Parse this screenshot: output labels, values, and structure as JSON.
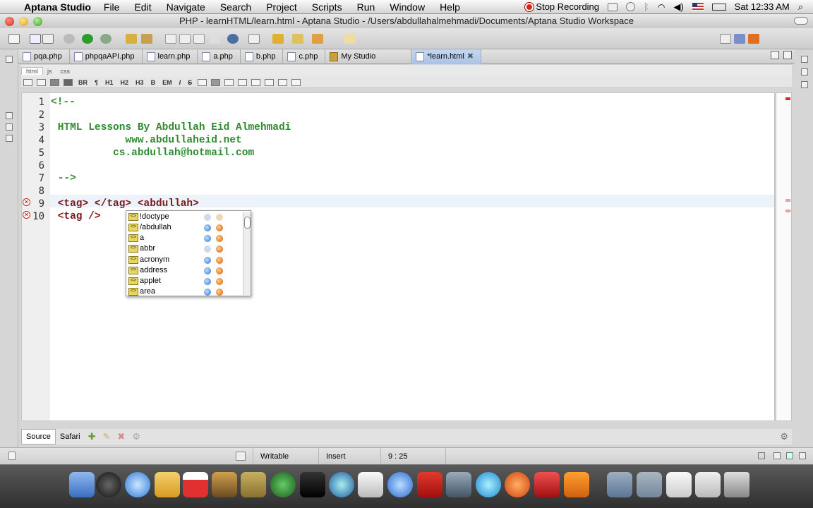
{
  "menubar": {
    "app_name": "Aptana Studio",
    "menus": [
      "File",
      "Edit",
      "Navigate",
      "Search",
      "Project",
      "Scripts",
      "Run",
      "Window",
      "Help"
    ],
    "stop_recording": "Stop Recording",
    "clock": "Sat 12:33 AM"
  },
  "window": {
    "title": "PHP - learnHTML/learn.html - Aptana Studio - /Users/abdullahalmehmadi/Documents/Aptana Studio Workspace"
  },
  "editor_tabs": [
    {
      "label": "pqa.php"
    },
    {
      "label": "phpqaAPI.php"
    },
    {
      "label": "learn.php"
    },
    {
      "label": "a.php"
    },
    {
      "label": "b.php"
    },
    {
      "label": "c.php"
    },
    {
      "label": "My Studio"
    },
    {
      "label": "*learn.html",
      "active": true
    }
  ],
  "sub_tabs": [
    "html",
    "js",
    "css"
  ],
  "format_toolbar": [
    "BR",
    "¶",
    "H1",
    "H2",
    "H3",
    "B",
    "EM",
    "I",
    "S"
  ],
  "code_lines": [
    {
      "num": "1",
      "text": "<!--"
    },
    {
      "num": "2",
      "text": ""
    },
    {
      "num": "3",
      "text": " HTML Lessons By Abdullah Eid Almehmadi"
    },
    {
      "num": "4",
      "text": "            www.abdullaheid.net"
    },
    {
      "num": "5",
      "text": "          cs.abdullah@hotmail.com"
    },
    {
      "num": "6",
      "text": ""
    },
    {
      "num": "7",
      "text": " -->"
    },
    {
      "num": "8",
      "text": ""
    },
    {
      "num": "9",
      "text": " <tag> </tag> <abdullah>"
    },
    {
      "num": "10",
      "text": " <tag />"
    }
  ],
  "autocomplete": {
    "items": [
      "!doctype",
      "/abdullah",
      "a",
      "abbr",
      "acronym",
      "address",
      "applet",
      "area"
    ]
  },
  "bottom_tabs": [
    "Source",
    "Safari"
  ],
  "status": {
    "mode": "Writable",
    "insert": "Insert",
    "position": "9 : 25"
  },
  "icons": {
    "apple": "apple-icon",
    "close_tab": "close-icon",
    "error": "error-icon",
    "tag": "tag-icon"
  },
  "colors": {
    "comment": "#2f8b2f",
    "tag": "#7a1a1a",
    "active_tab": "#a8c2e6",
    "error": "#cc2222"
  }
}
